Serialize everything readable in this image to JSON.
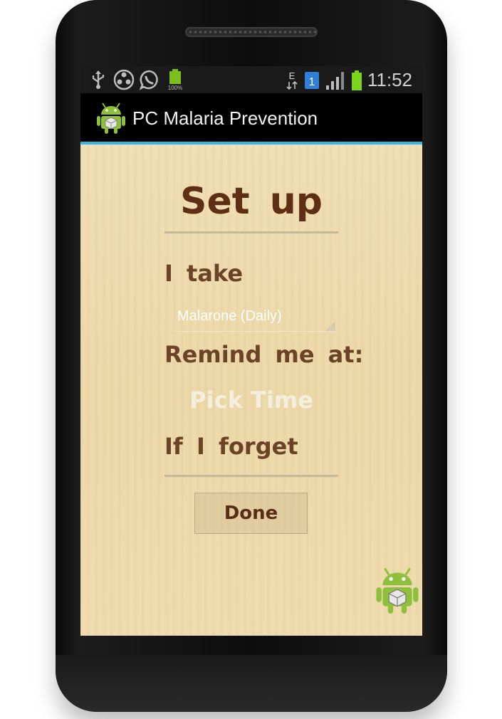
{
  "status_bar": {
    "icons_left": [
      "usb-icon",
      "media-icon",
      "whatsapp-icon",
      "battery-full-icon"
    ],
    "battery_small_label": "100%",
    "network_type": "E",
    "notification_count": "1",
    "time": "11:52"
  },
  "action_bar": {
    "app_title": "PC Malaria Prevention"
  },
  "setup": {
    "title": "Set up",
    "i_take_label": "I take",
    "medication_selected": "Malarone (Daily)",
    "remind_label": "Remind me at:",
    "pick_time_label": "Pick Time",
    "forget_label": "If I forget",
    "done_label": "Done"
  },
  "colors": {
    "accent": "#33b5e5",
    "title_brown": "#5e2f15",
    "label_brown": "#6b4326",
    "android_green": "#8fc03c"
  }
}
